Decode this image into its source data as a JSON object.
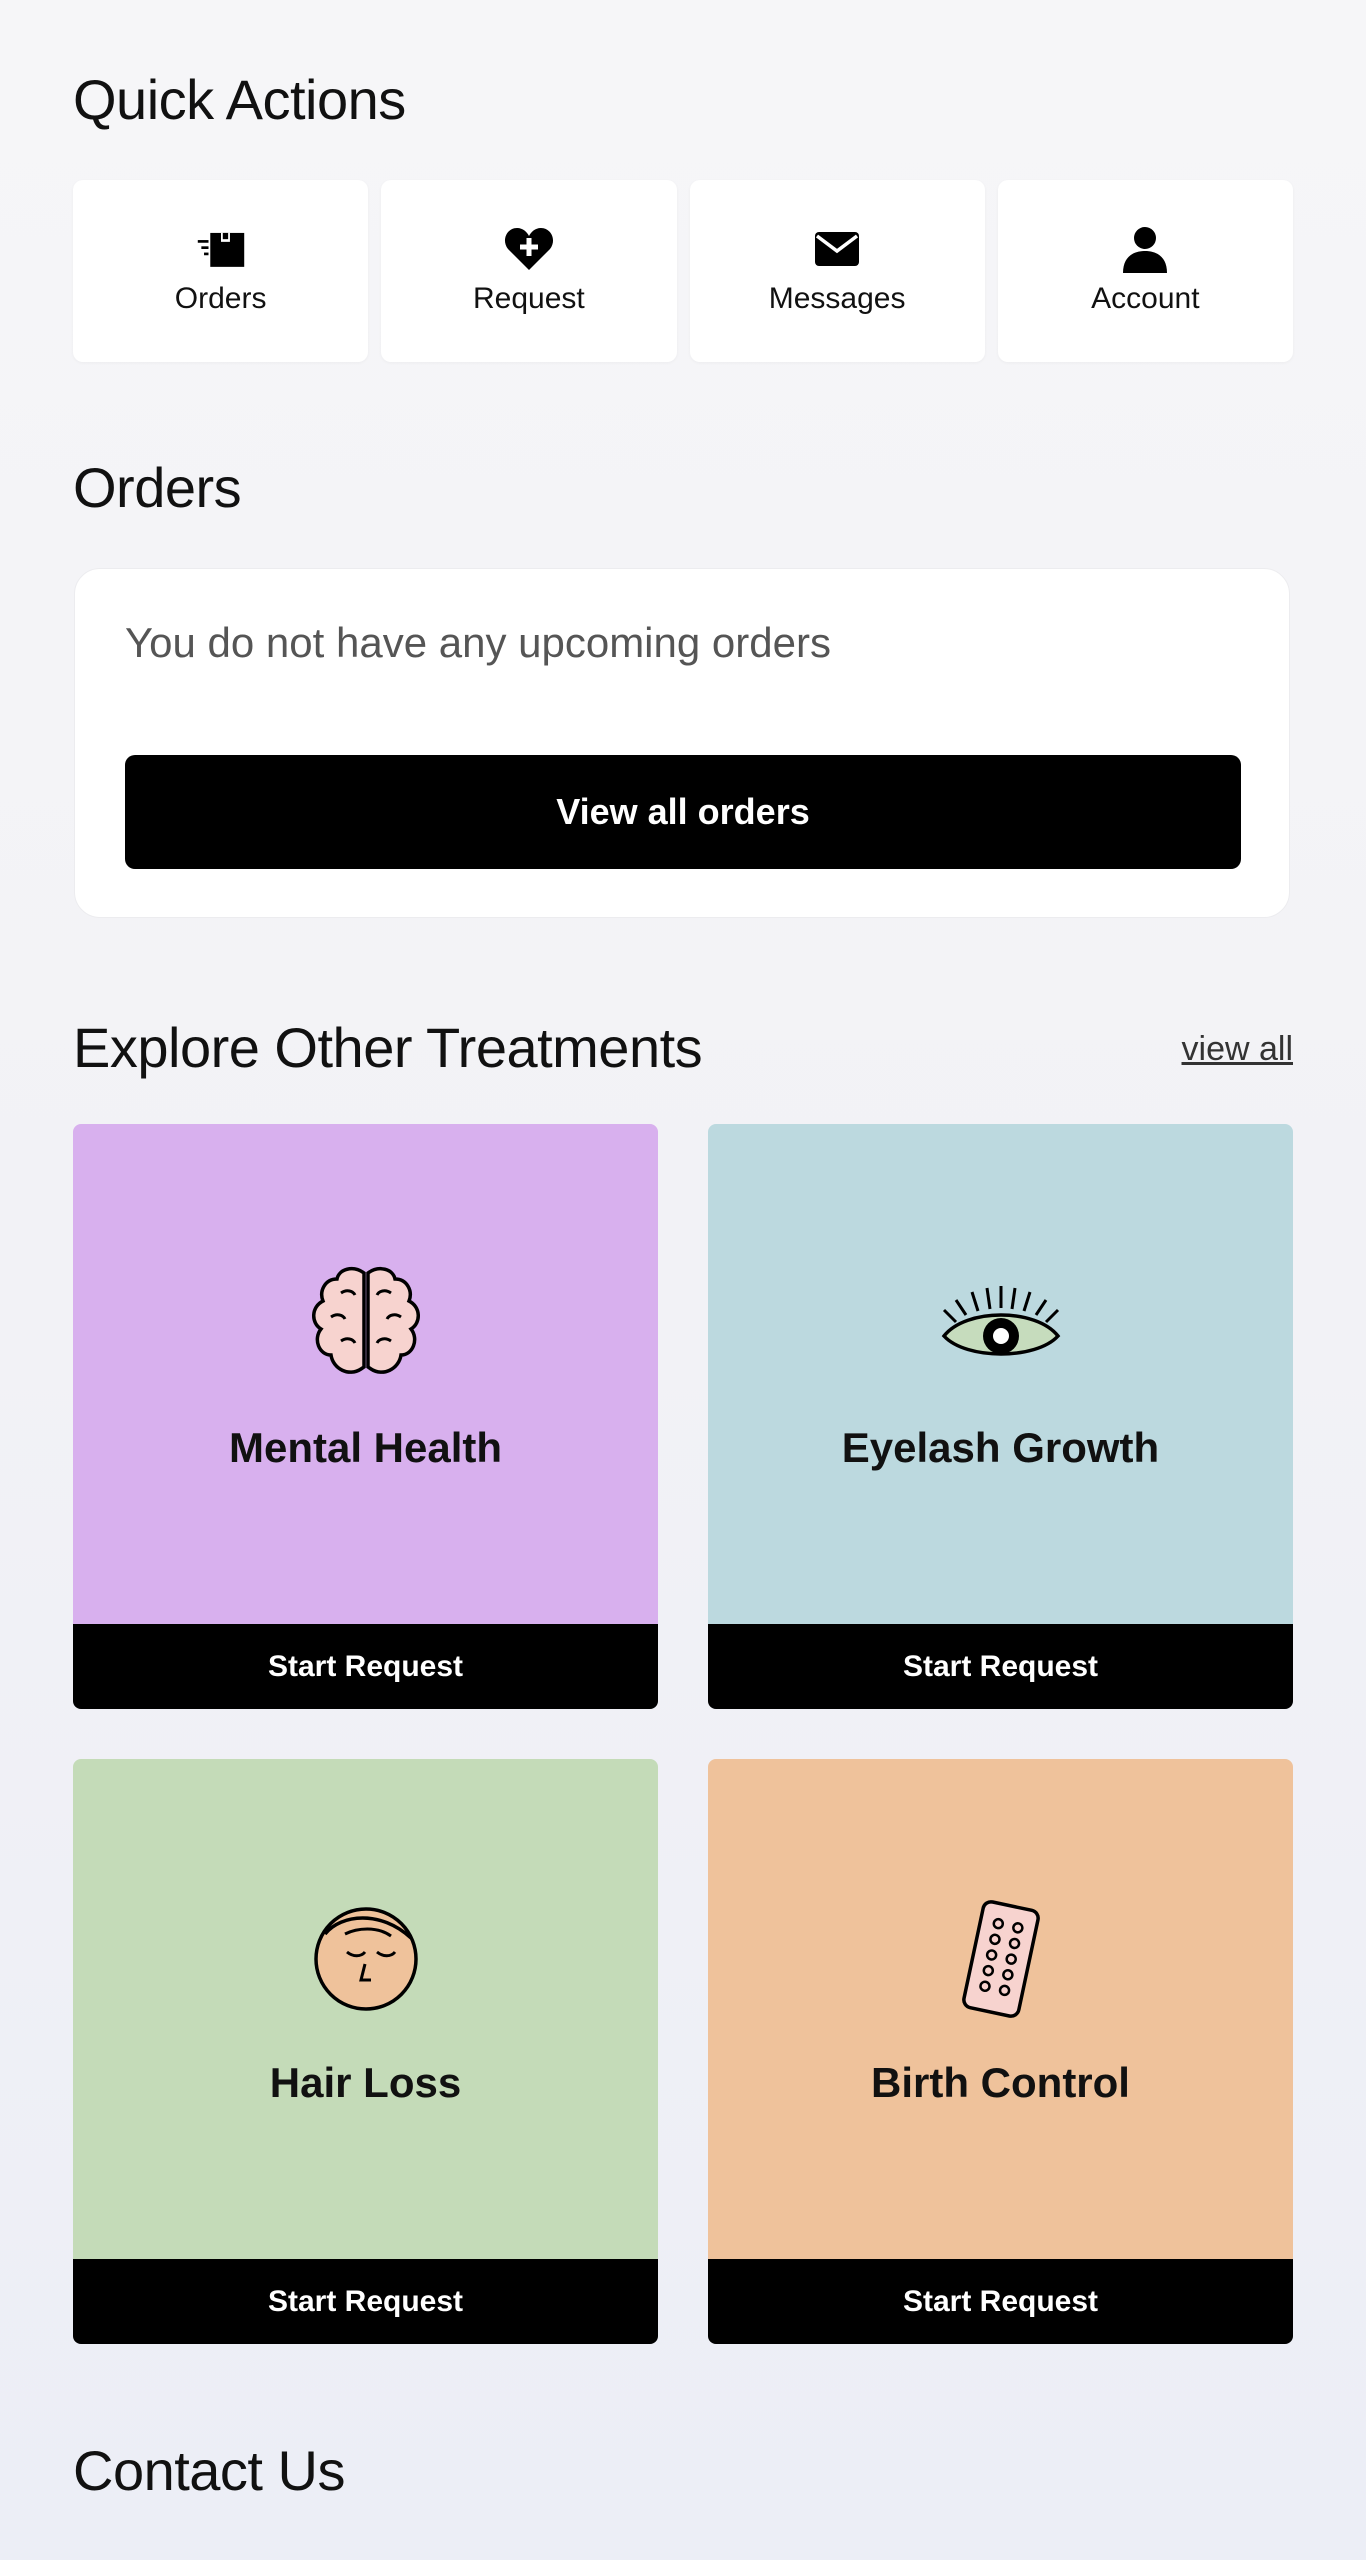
{
  "quick_actions": {
    "title": "Quick Actions",
    "items": [
      {
        "label": "Orders",
        "icon": "orders-box-icon"
      },
      {
        "label": "Request",
        "icon": "heart-plus-icon"
      },
      {
        "label": "Messages",
        "icon": "envelope-icon"
      },
      {
        "label": "Account",
        "icon": "user-icon"
      }
    ]
  },
  "orders": {
    "title": "Orders",
    "empty_message": "You do not have any upcoming orders",
    "button_label": "View all orders"
  },
  "treatments": {
    "title": "Explore Other Treatments",
    "view_all_label": "view all",
    "items": [
      {
        "name": "Mental Health",
        "button": "Start Request",
        "color": "#d8b0ee",
        "icon": "brain-icon"
      },
      {
        "name": "Eyelash Growth",
        "button": "Start Request",
        "color": "#bcd9df",
        "icon": "eye-icon"
      },
      {
        "name": "Hair Loss",
        "button": "Start Request",
        "color": "#c4dbb8",
        "icon": "face-icon"
      },
      {
        "name": "Birth Control",
        "button": "Start Request",
        "color": "#efc29b",
        "icon": "pill-pack-icon"
      }
    ]
  },
  "contact": {
    "title": "Contact Us"
  }
}
